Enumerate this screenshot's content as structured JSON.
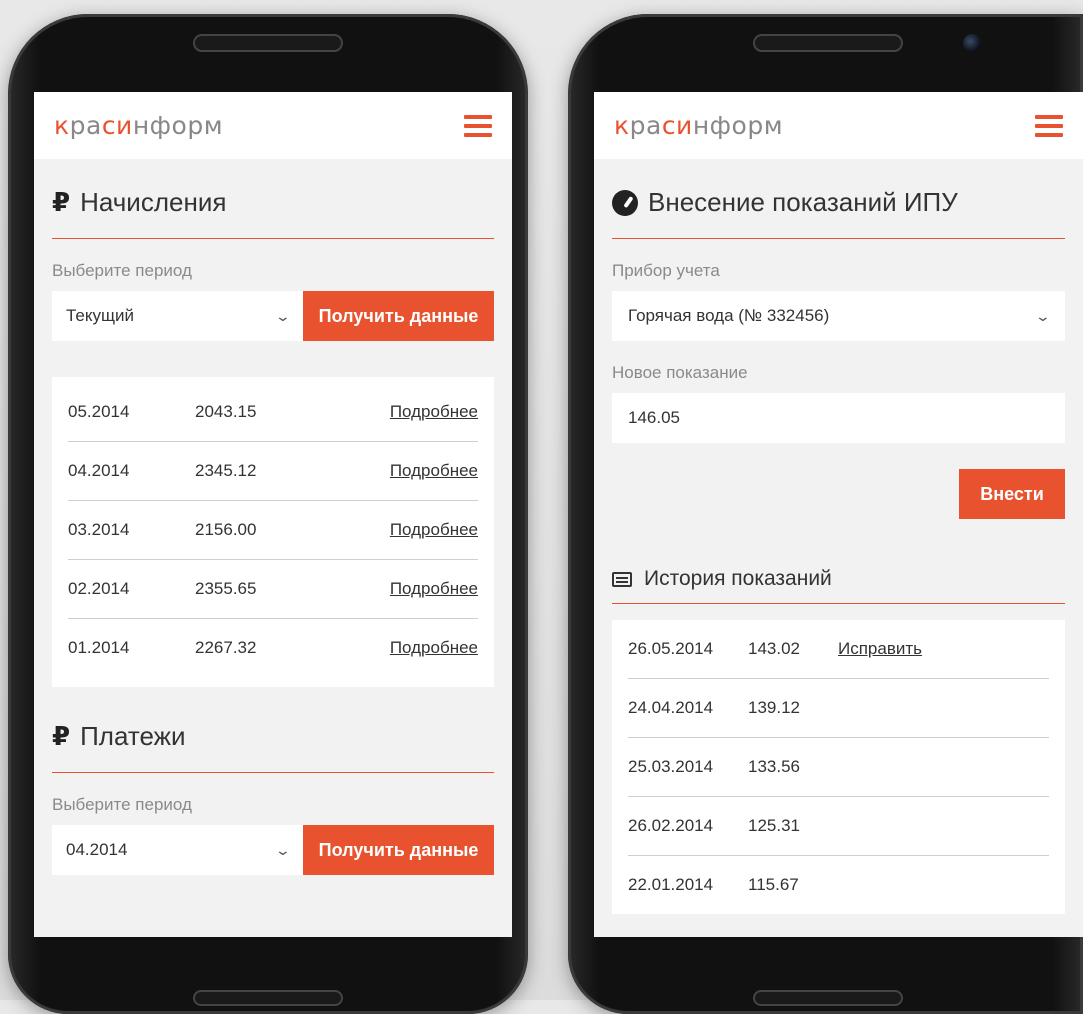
{
  "brand": {
    "logo_accent_1": "к",
    "logo_mid_1": "ра",
    "logo_accent_2": "си",
    "logo_rest": "нформ"
  },
  "left": {
    "charges": {
      "title": "Начисления",
      "period_label": "Выберите период",
      "period_value": "Текущий",
      "button_label": "Получить данные",
      "rows": [
        {
          "period": "05.2014",
          "amount": "2043.15",
          "link": "Подробнее"
        },
        {
          "period": "04.2014",
          "amount": "2345.12",
          "link": "Подробнее"
        },
        {
          "period": "03.2014",
          "amount": "2156.00",
          "link": "Подробнее"
        },
        {
          "period": "02.2014",
          "amount": "2355.65",
          "link": "Подробнее"
        },
        {
          "period": "01.2014",
          "amount": "2267.32",
          "link": "Подробнее"
        }
      ]
    },
    "payments": {
      "title": "Платежи",
      "period_label": "Выберите период",
      "period_value": "04.2014",
      "button_label": "Получить данные"
    }
  },
  "right": {
    "title": "Внесение показаний ИПУ",
    "meter_label": "Прибор учета",
    "meter_value": "Горячая вода (№ 332456)",
    "reading_label": "Новое показание",
    "reading_value": "146.05",
    "submit_label": "Внести",
    "history_title": "История показаний",
    "history": [
      {
        "date": "26.05.2014",
        "value": "143.02",
        "link": "Исправить"
      },
      {
        "date": "24.04.2014",
        "value": "139.12",
        "link": ""
      },
      {
        "date": "25.03.2014",
        "value": "133.56",
        "link": ""
      },
      {
        "date": "26.02.2014",
        "value": "125.31",
        "link": ""
      },
      {
        "date": "22.01.2014",
        "value": "115.67",
        "link": ""
      }
    ]
  },
  "icons": {
    "ruble": "₽",
    "chevron": "⌄"
  },
  "colors": {
    "accent": "#e8522e",
    "background": "#f2f2f2"
  }
}
